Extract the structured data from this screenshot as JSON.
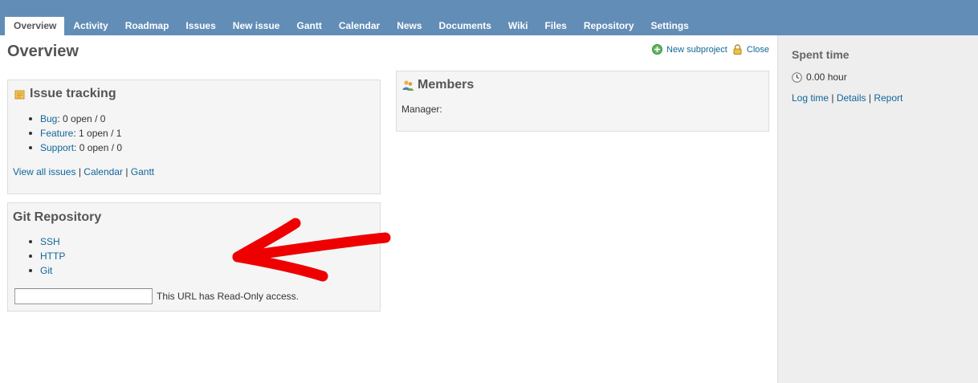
{
  "menu": {
    "items": [
      {
        "label": "Overview",
        "selected": true
      },
      {
        "label": "Activity"
      },
      {
        "label": "Roadmap"
      },
      {
        "label": "Issues"
      },
      {
        "label": "New issue"
      },
      {
        "label": "Gantt"
      },
      {
        "label": "Calendar"
      },
      {
        "label": "News"
      },
      {
        "label": "Documents"
      },
      {
        "label": "Wiki"
      },
      {
        "label": "Files"
      },
      {
        "label": "Repository"
      },
      {
        "label": "Settings"
      }
    ]
  },
  "page": {
    "title": "Overview",
    "actions": {
      "new_subproject": "New subproject",
      "close": "Close"
    }
  },
  "issue_tracking": {
    "title": "Issue tracking",
    "trackers": [
      {
        "name": "Bug",
        "counts": ": 0 open / 0"
      },
      {
        "name": "Feature",
        "counts": ": 1 open / 1"
      },
      {
        "name": "Support",
        "counts": ": 0 open / 0"
      }
    ],
    "links": {
      "view_all": "View all issues",
      "calendar": "Calendar",
      "gantt": "Gantt",
      "sep": " | "
    }
  },
  "git_repository": {
    "title": "Git Repository",
    "protocols": [
      "SSH",
      "HTTP",
      "Git"
    ],
    "url_value": "",
    "access_note": "This URL has Read-Only access."
  },
  "members": {
    "title": "Members",
    "manager_label": "Manager:"
  },
  "sidebar": {
    "title": "Spent time",
    "hours": "0.00 hour",
    "links": {
      "log_time": "Log time",
      "details": "Details",
      "report": "Report",
      "sep": " | "
    }
  },
  "colors": {
    "menu_bg": "#628db6",
    "link": "#116699",
    "annotation_arrow": "#ee0000"
  }
}
